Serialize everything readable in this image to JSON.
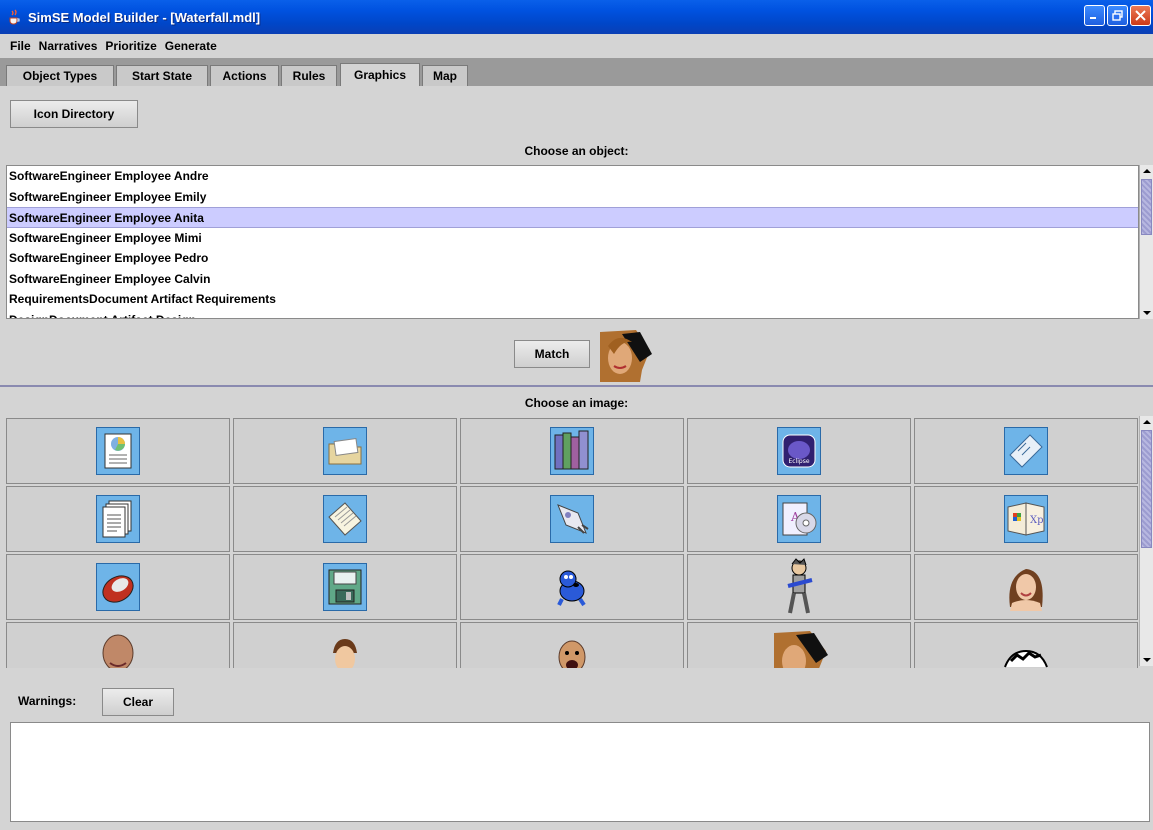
{
  "window": {
    "title": "SimSE Model Builder - [Waterfall.mdl]"
  },
  "menu": [
    "File",
    "Narratives",
    "Prioritize",
    "Generate"
  ],
  "tabs": [
    {
      "label": "Object Types",
      "active": false
    },
    {
      "label": "Start State",
      "active": false
    },
    {
      "label": "Actions",
      "active": false
    },
    {
      "label": "Rules",
      "active": false
    },
    {
      "label": "Graphics",
      "active": true
    },
    {
      "label": "Map",
      "active": false
    }
  ],
  "toolbar": {
    "icon_directory_label": "Icon Directory"
  },
  "object_section": {
    "label": "Choose an object:",
    "items": [
      "SoftwareEngineer Employee Andre",
      "SoftwareEngineer Employee Emily",
      "SoftwareEngineer Employee Anita",
      "SoftwareEngineer Employee Mimi",
      "SoftwareEngineer Employee Pedro",
      "SoftwareEngineer Employee Calvin",
      "RequirementsDocument Artifact Requirements",
      "DesignDocument Artifact Design"
    ],
    "selected_index": 2
  },
  "match": {
    "button_label": "Match",
    "matched_image": "woman-portrait-icon"
  },
  "image_section": {
    "label": "Choose an image:",
    "images": [
      "report-pie-chart-icon",
      "folder-icon",
      "books-icon",
      "eclipse-icon",
      "ruler-icon",
      "documents-icon",
      "notepad-icon",
      "rocket-icon",
      "cd-case-icon",
      "windows-xp-icon",
      "mouse-icon",
      "floppy-disk-icon",
      "blue-dog-icon",
      "guitarist-icon",
      "smiling-woman-icon",
      "bald-man-icon",
      "young-man-icon",
      "screaming-man-icon",
      "woman-portrait-icon",
      "cartoon-face-icon"
    ]
  },
  "warnings": {
    "label": "Warnings:",
    "clear_label": "Clear"
  },
  "colors": {
    "titlebar": "#0052e0",
    "selection": "#ccccff",
    "tabstrip": "#9a9a9a"
  }
}
